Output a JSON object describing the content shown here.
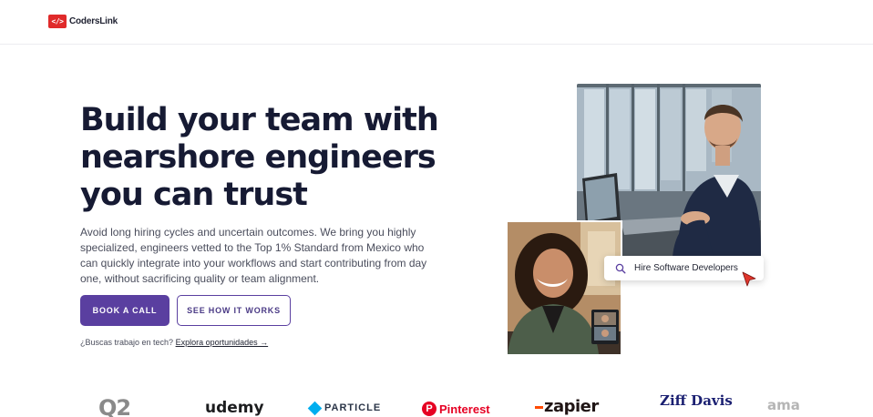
{
  "brand": {
    "logo_mark": "</>",
    "name": "CodersLink"
  },
  "hero": {
    "title_lines": [
      "Build your team with",
      "nearshore engineers",
      "you can trust"
    ],
    "description": "Avoid long hiring cycles and uncertain outcomes. We bring you highly specialized, engineers vetted to the Top 1% Standard from Mexico who can quickly integrate into your workflows and start contributing from day one, without sacrificing quality or team alignment.",
    "primary_button": "BOOK A CALL",
    "secondary_button": "SEE HOW IT WORKS",
    "job_prompt": "¿Buscas trabajo en tech?",
    "job_link": "Explora oportunidades →"
  },
  "search_card": {
    "text": "Hire Software Developers",
    "icon": "search-icon"
  },
  "client_logos": [
    {
      "name": "Q2"
    },
    {
      "name": "udemy"
    },
    {
      "name": "PARTICLE"
    },
    {
      "name": "Pinterest"
    },
    {
      "name": "zapier"
    },
    {
      "name": "Ziff Davis"
    },
    {
      "name": "ama"
    }
  ],
  "colors": {
    "accent": "#5a3fa0",
    "logo_red": "#e02a2a",
    "heading": "#161a33",
    "cursor": "#e0362c"
  }
}
